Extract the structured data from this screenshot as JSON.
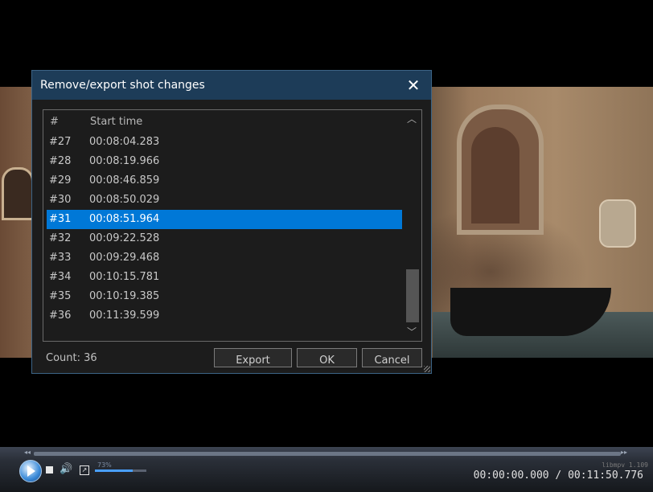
{
  "dialog": {
    "title": "Remove/export shot changes",
    "close_glyph": "✕",
    "list": {
      "columns": [
        "#",
        "Start time"
      ],
      "rows": [
        {
          "num": "#27",
          "time": "00:08:04.283"
        },
        {
          "num": "#28",
          "time": "00:08:19.966"
        },
        {
          "num": "#29",
          "time": "00:08:46.859"
        },
        {
          "num": "#30",
          "time": "00:08:50.029"
        },
        {
          "num": "#31",
          "time": "00:08:51.964"
        },
        {
          "num": "#32",
          "time": "00:09:22.528"
        },
        {
          "num": "#33",
          "time": "00:09:29.468"
        },
        {
          "num": "#34",
          "time": "00:10:15.781"
        },
        {
          "num": "#35",
          "time": "00:10:19.385"
        },
        {
          "num": "#36",
          "time": "00:11:39.599"
        }
      ],
      "selected_index": 4,
      "scroll_up_glyph": "︿",
      "scroll_down_glyph": "﹀"
    },
    "count_label": "Count: 36",
    "buttons": {
      "export": "Export",
      "ok": "OK",
      "cancel": "Cancel"
    }
  },
  "player": {
    "volume_label": "73%",
    "volume_percent": 73,
    "seek_left_glyph": "◂◂",
    "seek_right_glyph": "▸▸",
    "volume_glyph": "🔊",
    "fullscreen_glyph": "↗",
    "engine_label": "libmpv 1.109",
    "timecode": "00:00:00.000 / 00:11:50.776"
  },
  "colors": {
    "selection": "#0078d7",
    "titlebar": "#1d3c58",
    "dialog_bg": "#1c1c1c"
  }
}
